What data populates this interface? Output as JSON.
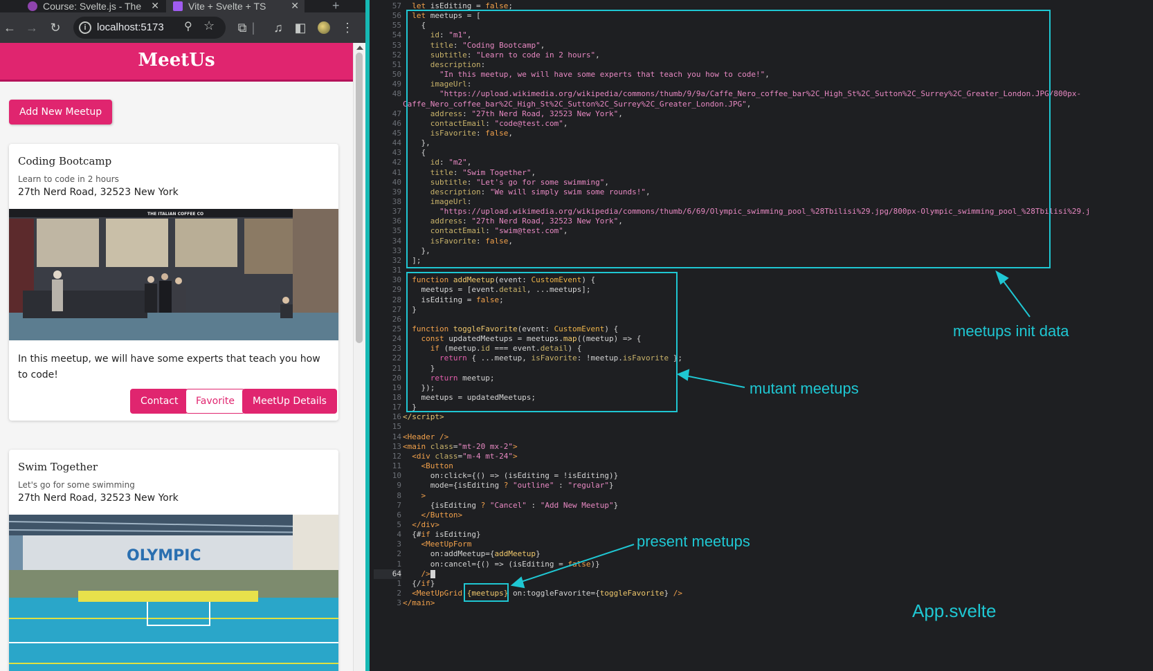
{
  "browser": {
    "tabs": [
      {
        "title": "Course: Svelte.js - The",
        "favicon_color": "#8e44ad"
      },
      {
        "title": "Vite + Svelte + TS",
        "favicon_color": "#a05cf0"
      }
    ],
    "close_glyph": "✕",
    "new_tab_glyph": "+",
    "url": "localhost:5173"
  },
  "app": {
    "brand_color": "#e0256f",
    "title": "MeetUs",
    "add_button": "Add New Meetup",
    "meetups": [
      {
        "title": "Coding Bootcamp",
        "subtitle": "Learn to code in 2 hours",
        "address": "27th Nerd Road, 32523 New York",
        "image_sign": "THE ITALIAN COFFEE CO",
        "description": "In this meetup, we will have some experts that teach you how to code!",
        "actions": [
          "Contact",
          "Favorite",
          "MeetUp Details"
        ]
      },
      {
        "title": "Swim Together",
        "subtitle": "Let's go for some swimming",
        "address": "27th Nerd Road, 32523 New York",
        "image_sign": "OLYMPIC"
      }
    ]
  },
  "editor": {
    "accent_color": "#1fc7d3",
    "lines": [
      {
        "n": "57",
        "html": "  <span class=\"kw\">let</span> isEditing = <span class=\"kw\">false</span>;"
      },
      {
        "n": "56",
        "html": "  <span class=\"kw\">let</span> meetups = ["
      },
      {
        "n": "55",
        "html": "    {"
      },
      {
        "n": "54",
        "html": "      <span class=\"prop\">id</span>: <span class=\"str\">\"m1\"</span>,"
      },
      {
        "n": "53",
        "html": "      <span class=\"prop\">title</span>: <span class=\"str\">\"Coding Bootcamp\"</span>,"
      },
      {
        "n": "52",
        "html": "      <span class=\"prop\">subtitle</span>: <span class=\"str\">\"Learn to code in 2 hours\"</span>,"
      },
      {
        "n": "51",
        "html": "      <span class=\"prop\">description</span>:"
      },
      {
        "n": "50",
        "html": "        <span class=\"str\">\"In this meetup, we will have some experts that teach you how to code!\"</span>,"
      },
      {
        "n": "49",
        "html": "      <span class=\"prop\">imageUrl</span>:"
      },
      {
        "n": "48",
        "html": "        <span class=\"str\">\"https://upload.wikimedia.org/wikipedia/commons/thumb/9/9a/Caffe_Nero_coffee_bar%2C_High_St%2C_Sutton%2C_Surrey%2C_Greater_London.JPG/800px-</span>"
      },
      {
        "n": "",
        "html": "<span class=\"str\">Caffe_Nero_coffee_bar%2C_High_St%2C_Sutton%2C_Surrey%2C_Greater_London.JPG\"</span>,"
      },
      {
        "n": "47",
        "html": "      <span class=\"prop\">address</span>: <span class=\"str\">\"27th Nerd Road, 32523 New York\"</span>,"
      },
      {
        "n": "46",
        "html": "      <span class=\"prop\">contactEmail</span>: <span class=\"str\">\"code@test.com\"</span>,"
      },
      {
        "n": "45",
        "html": "      <span class=\"prop\">isFavorite</span>: <span class=\"kw\">false</span>,"
      },
      {
        "n": "44",
        "html": "    },"
      },
      {
        "n": "43",
        "html": "    {"
      },
      {
        "n": "42",
        "html": "      <span class=\"prop\">id</span>: <span class=\"str\">\"m2\"</span>,"
      },
      {
        "n": "41",
        "html": "      <span class=\"prop\">title</span>: <span class=\"str\">\"Swim Together\"</span>,"
      },
      {
        "n": "40",
        "html": "      <span class=\"prop\">subtitle</span>: <span class=\"str\">\"Let's go for some swimming\"</span>,"
      },
      {
        "n": "39",
        "html": "      <span class=\"prop\">description</span>: <span class=\"str\">\"We will simply swim some rounds!\"</span>,"
      },
      {
        "n": "38",
        "html": "      <span class=\"prop\">imageUrl</span>:"
      },
      {
        "n": "37",
        "html": "        <span class=\"str\">\"https://upload.wikimedia.org/wikipedia/commons/thumb/6/69/Olympic_swimming_pool_%28Tbilisi%29.jpg/800px-Olympic_swimming_pool_%28Tbilisi%29.j</span>"
      },
      {
        "n": "36",
        "html": "      <span class=\"prop\">address</span>: <span class=\"str\">\"27th Nerd Road, 32523 New York\"</span>,"
      },
      {
        "n": "35",
        "html": "      <span class=\"prop\">contactEmail</span>: <span class=\"str\">\"swim@test.com\"</span>,"
      },
      {
        "n": "34",
        "html": "      <span class=\"prop\">isFavorite</span>: <span class=\"kw\">false</span>,"
      },
      {
        "n": "33",
        "html": "    },"
      },
      {
        "n": "32",
        "html": "  ];"
      },
      {
        "n": "31",
        "html": ""
      },
      {
        "n": "30",
        "html": "  <span class=\"kw\">function</span> <span class=\"fn\">addMeetup</span>(event: <span class=\"tp\">CustomEvent</span>) {"
      },
      {
        "n": "29",
        "html": "    meetups = [event.<span class=\"prop\">detail</span>, ...meetups];"
      },
      {
        "n": "28",
        "html": "    isEditing = <span class=\"kw\">false</span>;"
      },
      {
        "n": "27",
        "html": "  }"
      },
      {
        "n": "26",
        "html": ""
      },
      {
        "n": "25",
        "html": "  <span class=\"kw\">function</span> <span class=\"fn\">toggleFavorite</span>(event: <span class=\"tp\">CustomEvent</span>) {"
      },
      {
        "n": "24",
        "html": "    <span class=\"kw\">const</span> updatedMeetups = meetups.<span class=\"fn\">map</span>((meetup) =&gt; {"
      },
      {
        "n": "23",
        "html": "      <span class=\"kw\">if</span> (meetup.<span class=\"prop\">id</span> === event.<span class=\"prop\">detail</span>) {"
      },
      {
        "n": "22",
        "html": "        <span class=\"ret\">return</span> { ...meetup, <span class=\"prop\">isFavorite</span>: !meetup.<span class=\"prop\">isFavorite</span> };"
      },
      {
        "n": "21",
        "html": "      }"
      },
      {
        "n": "20",
        "html": "      <span class=\"ret\">return</span> meetup;"
      },
      {
        "n": "19",
        "html": "    });"
      },
      {
        "n": "18",
        "html": "    meetups = updatedMeetups;"
      },
      {
        "n": "17",
        "html": "  }"
      },
      {
        "n": "16",
        "html": "<span class=\"tag\">&lt;/script&gt;</span>"
      },
      {
        "n": "15",
        "html": ""
      },
      {
        "n": "14",
        "html": "<span class=\"comp\">&lt;Header</span> <span class=\"comp\">/&gt;</span>"
      },
      {
        "n": "13",
        "html": "<span class=\"comp\">&lt;main</span> <span class=\"prop\">class</span>=<span class=\"str\">\"mt-20 mx-2\"</span><span class=\"comp\">&gt;</span>"
      },
      {
        "n": "12",
        "html": "  <span class=\"comp\">&lt;div</span> <span class=\"prop\">class</span>=<span class=\"str\">\"m-4 mt-24\"</span><span class=\"comp\">&gt;</span>"
      },
      {
        "n": "11",
        "html": "    <span class=\"comp\">&lt;Button</span>"
      },
      {
        "n": "10",
        "html": "      on:click={() =&gt; (isEditing = !isEditing)}"
      },
      {
        "n": "9",
        "html": "      mode={isEditing <span class=\"kw\">?</span> <span class=\"str\">\"outline\"</span> : <span class=\"str\">\"regular\"</span>}"
      },
      {
        "n": "8",
        "html": "    <span class=\"comp\">&gt;</span>"
      },
      {
        "n": "7",
        "html": "      {isEditing <span class=\"kw\">?</span> <span class=\"str\">\"Cancel\"</span> : <span class=\"str\">\"Add New Meetup\"</span>}"
      },
      {
        "n": "6",
        "html": "    <span class=\"comp\">&lt;/Button&gt;</span>"
      },
      {
        "n": "5",
        "html": "  <span class=\"comp\">&lt;/div&gt;</span>"
      },
      {
        "n": "4",
        "html": "  {#<span class=\"kw\">if</span> isEditing}"
      },
      {
        "n": "3",
        "html": "    <span class=\"comp\">&lt;MeetUpForm</span>"
      },
      {
        "n": "2",
        "html": "      on:addMeetup={<span class=\"fn\">addMeetup</span>}"
      },
      {
        "n": "1",
        "html": "      on:cancel={() =&gt; (isEditing = <span class=\"kw\">false</span>)}"
      },
      {
        "n": "64",
        "html": "    <span class=\"comp\">/&gt;</span><span class=\"cursor-block\"></span>",
        "current": true
      },
      {
        "n": "1",
        "html": "  {/<span class=\"kw\">if</span>}"
      },
      {
        "n": "2",
        "html": "  <span class=\"comp\">&lt;MeetUpGrid</span> <span class=\"fn\">{meetups}</span> on:toggleFavorite={<span class=\"fn\">toggleFavorite</span>} <span class=\"comp\">/&gt;</span>"
      },
      {
        "n": "3",
        "html": "<span class=\"comp\">&lt;/main&gt;</span>"
      }
    ],
    "annotations": {
      "init_data": "meetups init data",
      "mutant": "mutant meetups",
      "present": "present meetups",
      "file": "App.svelte"
    }
  }
}
